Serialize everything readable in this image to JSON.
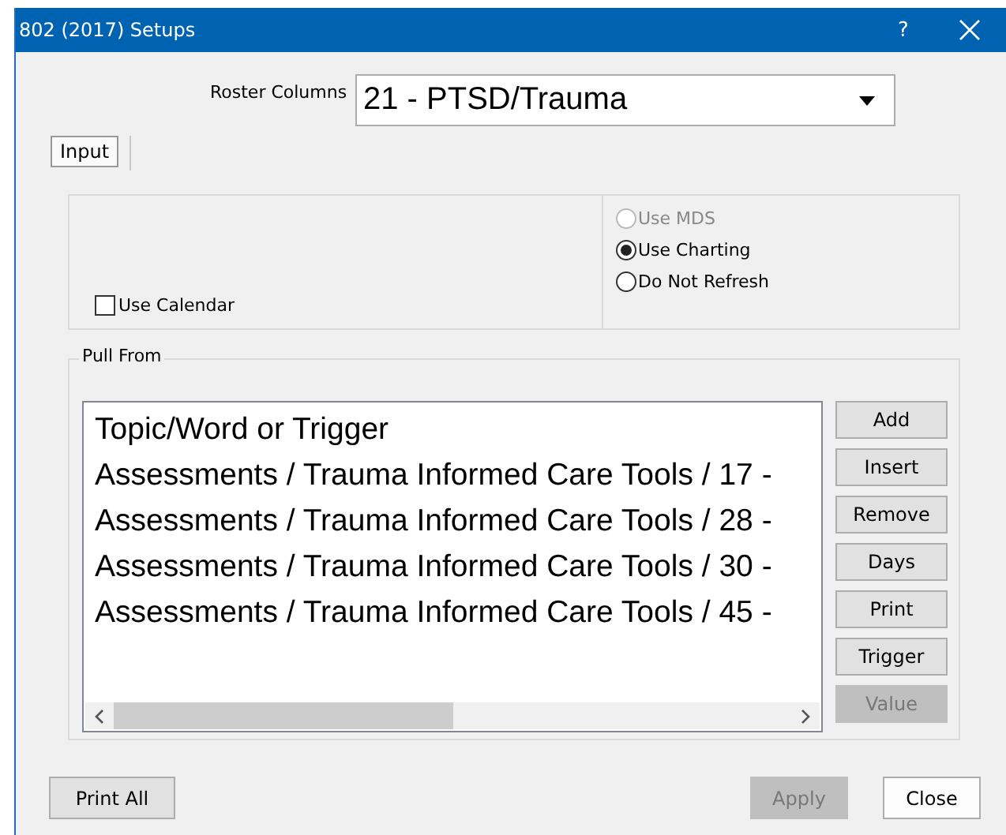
{
  "window": {
    "title": "802 (2017) Setups",
    "help": "?"
  },
  "roster": {
    "label": "Roster Columns",
    "value": "21 - PTSD/Trauma"
  },
  "tabs": [
    {
      "label": "Input",
      "selected": true
    }
  ],
  "options": {
    "checkbox": {
      "label": "Use Calendar",
      "checked": false
    },
    "radios": [
      {
        "label": "Use MDS",
        "selected": false,
        "disabled": true
      },
      {
        "label": "Use Charting",
        "selected": true,
        "disabled": false
      },
      {
        "label": "Do Not Refresh",
        "selected": false,
        "disabled": false
      }
    ]
  },
  "pull_from": {
    "title": "Pull From",
    "items": [
      "Topic/Word or Trigger",
      "Assessments / Trauma Informed Care Tools / 17 -",
      "Assessments / Trauma Informed Care Tools / 28 -",
      "Assessments / Trauma Informed Care Tools / 30 -",
      "Assessments / Trauma Informed Care Tools / 45 -"
    ],
    "buttons": [
      {
        "label": "Add",
        "disabled": false
      },
      {
        "label": "Insert",
        "disabled": false
      },
      {
        "label": "Remove",
        "disabled": false
      },
      {
        "label": "Days",
        "disabled": false
      },
      {
        "label": "Print",
        "disabled": false
      },
      {
        "label": "Trigger",
        "disabled": false
      },
      {
        "label": "Value",
        "disabled": true
      }
    ]
  },
  "footer": [
    {
      "label": "Print All",
      "disabled": false
    },
    {
      "label": "Apply",
      "disabled": true
    },
    {
      "label": "Close",
      "disabled": false
    }
  ]
}
